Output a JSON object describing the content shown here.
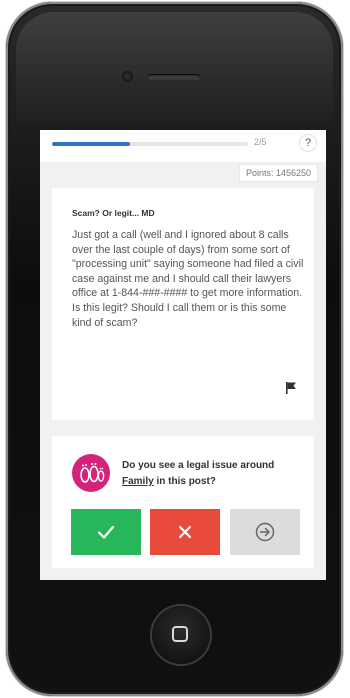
{
  "quiz": {
    "progress_label": "2/5",
    "progress_fraction": 0.4,
    "help_label": "?",
    "points_label": "Points: 1456250"
  },
  "post": {
    "title": "Scam? Or legit... MD",
    "body": "Just got a call (well and I ignored about 8 calls over the last couple of days) from some sort of \"processing unit\" saying someone had filed a civil case against me and I should call their lawyers office at 1-844-###-#### to get more information. Is this legit? Should I call them or is this some kind of scam?",
    "flag_icon": "flag-icon"
  },
  "question": {
    "text_before": "Do you see a legal issue around",
    "topic": "Family",
    "text_after": "in this post?",
    "avatar_icon": "family-feet-icon",
    "avatar_color": "#d4237a"
  },
  "actions": {
    "yes_icon": "checkmark-icon",
    "no_icon": "cross-icon",
    "skip_icon": "arrow-circle-icon",
    "yes_color": "#27b65a",
    "no_color": "#e84a3c",
    "skip_color": "#dcdcdc"
  }
}
